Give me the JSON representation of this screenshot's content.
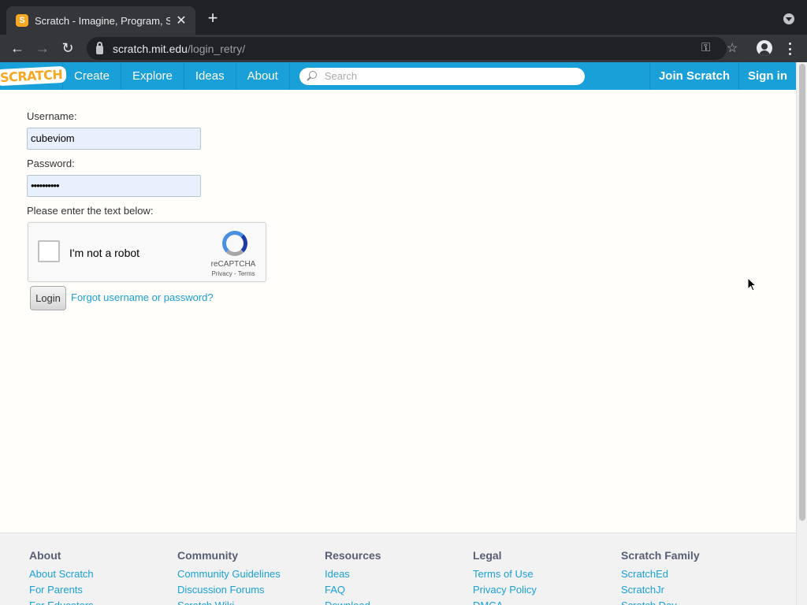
{
  "browser": {
    "tab_title": "Scratch - Imagine, Program, Sh",
    "url_host": "scratch.mit.edu",
    "url_path": "/login_retry/"
  },
  "nav": {
    "logo": "Scratch",
    "links": [
      "Create",
      "Explore",
      "Ideas",
      "About"
    ],
    "search_placeholder": "Search",
    "join": "Join Scratch",
    "signin": "Sign in"
  },
  "form": {
    "username_label": "Username:",
    "username_value": "cubeviom",
    "password_label": "Password:",
    "password_value": "••••••••••",
    "captcha_prompt": "Please enter the text below:",
    "captcha_check": "I'm not a robot",
    "captcha_brand": "reCAPTCHA",
    "captcha_terms": "Privacy - Terms",
    "login_button": "Login",
    "forgot_link": "Forgot username or password?"
  },
  "footer": {
    "columns": [
      {
        "title": "About",
        "links": [
          "About Scratch",
          "For Parents",
          "For Educators"
        ]
      },
      {
        "title": "Community",
        "links": [
          "Community Guidelines",
          "Discussion Forums",
          "Scratch Wiki"
        ]
      },
      {
        "title": "Resources",
        "links": [
          "Ideas",
          "FAQ",
          "Download"
        ]
      },
      {
        "title": "Legal",
        "links": [
          "Terms of Use",
          "Privacy Policy",
          "DMCA"
        ]
      },
      {
        "title": "Scratch Family",
        "links": [
          "ScratchEd",
          "ScratchJr",
          "Scratch Day"
        ]
      }
    ]
  },
  "colors": {
    "brand_blue": "#1aa0d8",
    "logo_orange": "#f7a823"
  }
}
